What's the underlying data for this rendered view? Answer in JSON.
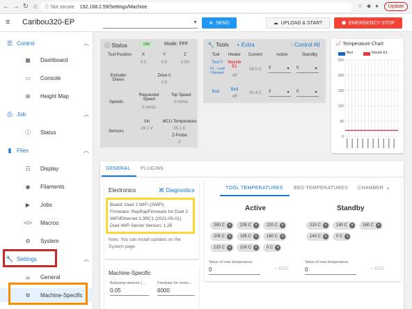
{
  "browser": {
    "back": "←",
    "forward": "→",
    "reload": "↻",
    "home": "⌂",
    "security": "ⓘ Not secure",
    "url": "192.168.2.59/Settings/Machine",
    "update_label": "Update"
  },
  "appbar": {
    "menu_icon": "≡",
    "title": "Caribou320-EP",
    "send_label": "SEND",
    "upload_label": "UPLOAD & START",
    "estop_label": "EMERGENCY STOP"
  },
  "sidebar": {
    "groups": [
      {
        "label": "Control",
        "icon": "settings-sliders-icon"
      },
      {
        "label": "Job",
        "icon": "printer-icon"
      },
      {
        "label": "Files",
        "icon": "folder-icon"
      },
      {
        "label": "Settings",
        "icon": "wrench-icon"
      }
    ],
    "items": [
      {
        "label": "Dashboard",
        "icon": "dashboard-icon"
      },
      {
        "label": "Console",
        "icon": "console-icon"
      },
      {
        "label": "Height Map",
        "icon": "grid-icon"
      },
      {
        "label": "Status",
        "icon": "info-icon"
      },
      {
        "label": "Display",
        "icon": "list-icon"
      },
      {
        "label": "Filaments",
        "icon": "radio-icon"
      },
      {
        "label": "Jobs",
        "icon": "play-icon"
      },
      {
        "label": "Macros",
        "icon": "code-icon"
      },
      {
        "label": "System",
        "icon": "gear-icon"
      },
      {
        "label": "General",
        "icon": "sliders-icon"
      },
      {
        "label": "Machine-Specific",
        "icon": "cogs-icon"
      }
    ]
  },
  "status": {
    "title": "Status",
    "badge": "Idle",
    "mode": "Mode: FFF",
    "tool_position": "Tool Position",
    "axes": [
      "X",
      "Y",
      "Z"
    ],
    "positions": [
      "0.0",
      "0.0",
      "0.00"
    ],
    "extruder_drives": "Extruder Drives",
    "drive_label": "Drive 0",
    "drive_value": "0.0",
    "speeds": "Speeds",
    "requested_speed": "Requested Speed",
    "requested_value": "0 mm/s",
    "top_speed": "Top Speed",
    "top_value": "0 mm/s",
    "sensors": "Sensors",
    "vin": "Vin",
    "vin_value": "24.1 V",
    "mcu": "MCU Temperature",
    "mcu_value": "35.1 C",
    "zprobe": "Z-Probe",
    "zprobe_value": "0"
  },
  "tools": {
    "title": "Tools",
    "extra": "+ Extra",
    "control_all": "- Control All",
    "headers": [
      "Tool",
      "Heater",
      "Current",
      "Active",
      "Standby"
    ],
    "tool0": "Tool 0",
    "tool0_sub": "T0 - Load Filament",
    "heater": "Nozzle E1",
    "heater_state": "off",
    "tool0_current": "19.0 C",
    "active_value": "0",
    "standby_value": "0",
    "bed": "Bed",
    "bed_heater": "Bed",
    "bed_state": "off",
    "bed_current": "20.4 C"
  },
  "tempchart": {
    "title": "Temperature Chart",
    "legend": [
      "Bed",
      "Nozzle E1"
    ],
    "colors": {
      "bed": "#1565c0",
      "nozzle": "#e53935"
    },
    "yticks": [
      "250",
      "200",
      "150",
      "100",
      "50",
      "0"
    ]
  },
  "chart_data": {
    "type": "line",
    "title": "Temperature Chart",
    "series": [
      {
        "name": "Bed",
        "values": [
          20,
          20,
          20,
          20,
          20,
          20,
          20,
          20,
          20,
          20
        ]
      },
      {
        "name": "Nozzle E1",
        "values": [
          19,
          19,
          19,
          19,
          19,
          19,
          19,
          19,
          19,
          19
        ]
      }
    ],
    "ylim": [
      0,
      250
    ]
  },
  "settings": {
    "tabs": [
      "GENERAL",
      "PLUGINS"
    ],
    "electronics_title": "Electronics",
    "diagnostics": "Diagnostics",
    "board": "Board: Duet 2 WiFi (2WiFi)",
    "firmware": "Firmware: RepRapFirmware for Duet 2 WiFi/Ethernet 3.3RC1 (2021-05-01)",
    "wifi": "Duet WiFi Server Version: 1.25",
    "note": "Note: You can install updates on the System page.",
    "machine_title": "Machine-Specific",
    "babystep_label": "Babystep amount (...",
    "babystep_value": "0.05",
    "feedrate_label": "Feedrate for move...",
    "feedrate_value": "6000"
  },
  "temps": {
    "tabs": [
      "TOOL TEMPERATURES",
      "BED TEMPERATURES",
      "CHAMBER"
    ],
    "active_title": "Active",
    "standby_title": "Standby",
    "active_chips": [
      "250 C",
      "235 C",
      "220 C",
      "205 C",
      "195 C",
      "160 C",
      "120 C",
      "100 C",
      "0 C"
    ],
    "standby_chips": [
      "210 C",
      "180 C",
      "160 C",
      "140 C",
      "0 C"
    ],
    "new_temp_label": "Value of new temperature",
    "new_temp_value": "0",
    "add_label": "+ ADD"
  }
}
